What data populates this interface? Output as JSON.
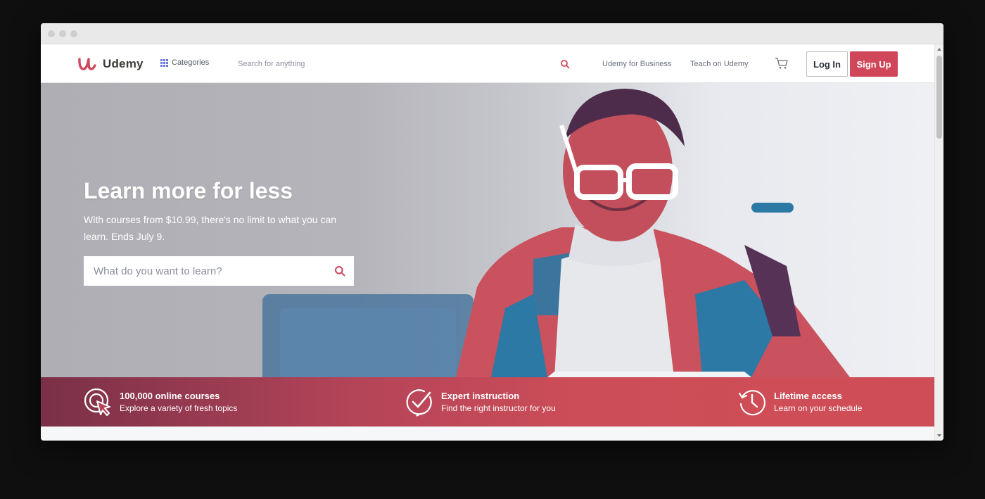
{
  "brand": {
    "name": "Udemy",
    "color": "#d0475a"
  },
  "navbar": {
    "categories_label": "Categories",
    "search_placeholder": "Search for anything",
    "business_link": "Udemy for Business",
    "teach_link": "Teach on Udemy",
    "login_label": "Log In",
    "signup_label": "Sign Up"
  },
  "hero": {
    "title": "Learn more for less",
    "subtitle": "With courses from $10.99, there's no limit to what you can learn. Ends July 9.",
    "search_placeholder": "What do you want to learn?"
  },
  "features": [
    {
      "icon": "cursor-click-icon",
      "title": "100,000 online courses",
      "desc": "Explore a variety of fresh topics"
    },
    {
      "icon": "check-badge-icon",
      "title": "Expert instruction",
      "desc": "Find the right instructor for you"
    },
    {
      "icon": "history-clock-icon",
      "title": "Lifetime access",
      "desc": "Learn on your schedule"
    }
  ],
  "colors": {
    "accent": "#d0475a",
    "feature_bar_start": "#7a3048",
    "feature_bar_end": "#cf4d56"
  }
}
